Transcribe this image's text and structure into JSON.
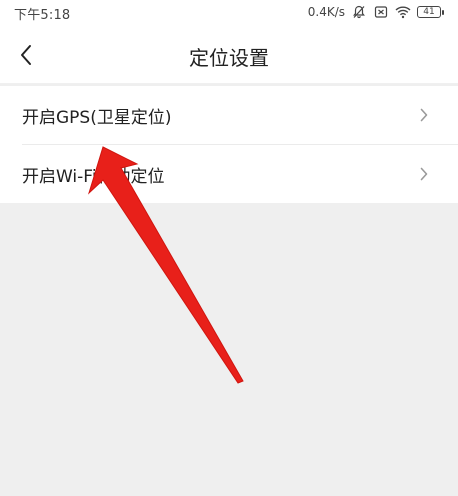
{
  "status_bar": {
    "time": "下午5:18",
    "network_speed": "0.4K/s",
    "battery": "41",
    "icons": [
      "bell-off-icon",
      "sim-icon",
      "wifi-icon",
      "battery-icon"
    ]
  },
  "nav": {
    "back_icon": "chevron-left-icon",
    "title": "定位设置"
  },
  "menu": {
    "items": [
      {
        "label": "开启GPS(卫星定位)",
        "icon": "chevron-right-icon"
      },
      {
        "label": "开启Wi-Fi辅助定位",
        "icon": "chevron-right-icon"
      }
    ]
  },
  "colors": {
    "background": "#efefef",
    "surface": "#ffffff",
    "text": "#222222",
    "chevron": "#9a9a9a",
    "arrow": "#e8201a"
  }
}
